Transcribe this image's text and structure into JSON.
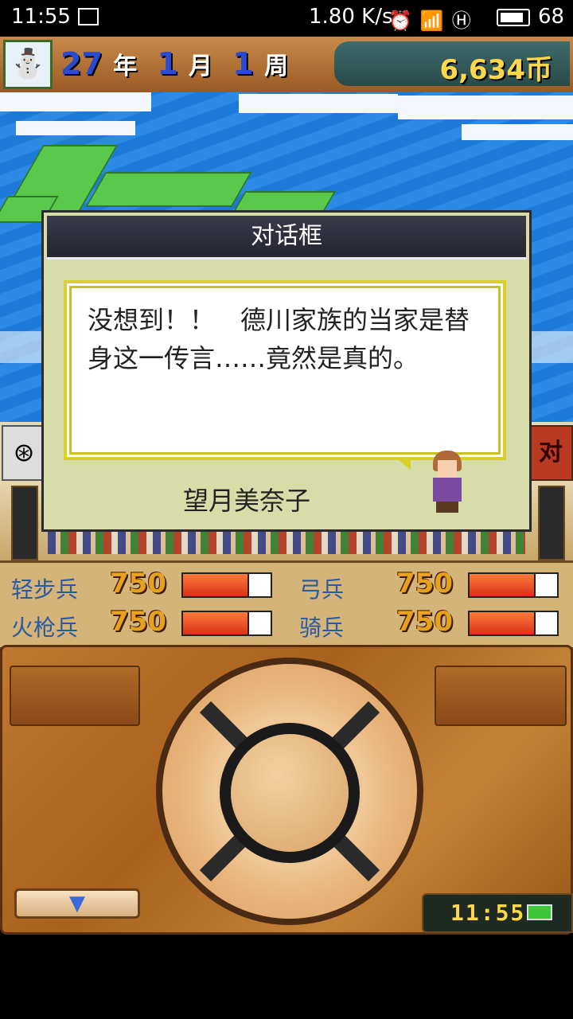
{
  "status_bar": {
    "time": "11:55",
    "net_speed": "1.80 K/s",
    "icons": [
      "image-icon",
      "alarm-icon",
      "signal-4g-icon",
      "hd-icon",
      "battery-icon"
    ],
    "battery": "68"
  },
  "header": {
    "year_num": "27",
    "year_unit": "年",
    "month_num": "1",
    "month_unit": "月",
    "week_num": "1",
    "week_unit": "周",
    "coins": "6,634币"
  },
  "dialog": {
    "title": "对话框",
    "message": "没想到！！　德川家族的当家是替身这一传言……竟然是真的。",
    "speaker": "望月美奈子"
  },
  "battle": {
    "vs_label": "对"
  },
  "troops": [
    {
      "name": "轻步兵",
      "value": "750",
      "hp_fraction": 0.75
    },
    {
      "name": "弓兵",
      "value": "750",
      "hp_fraction": 0.75
    },
    {
      "name": "火枪兵",
      "value": "750",
      "hp_fraction": 0.75
    },
    {
      "name": "骑兵",
      "value": "750",
      "hp_fraction": 0.75
    }
  ],
  "controls": {
    "down_arrow": "▼",
    "clock": "11:55"
  },
  "colors": {
    "accent_gold": "#ffd84a",
    "label_blue": "#2a5aa0",
    "hp_red": "#d8301a"
  }
}
